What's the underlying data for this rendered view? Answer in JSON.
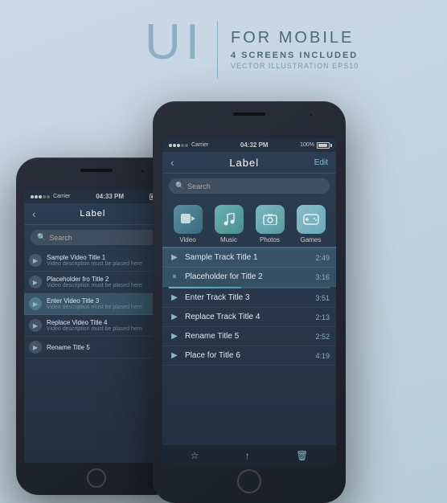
{
  "header": {
    "ui_letters": "UI",
    "divider": "|",
    "for_mobile": "FOR MOBILE",
    "screens_included": "4 SCREENS INCLUDED",
    "vector_info": "VECTOR ILLUSTRATION EPS10"
  },
  "phone_left": {
    "status": {
      "carrier": "Carrier",
      "time": "04:33 PM"
    },
    "nav": {
      "back": "‹",
      "title": "Label"
    },
    "search_placeholder": "Search",
    "videos": [
      {
        "title": "Sample Video Title 1",
        "desc": "Video description must be plased here",
        "active": false
      },
      {
        "title": "Placeholder fro Title 2",
        "desc": "Video description must be plased here",
        "active": false
      },
      {
        "title": "Enter Video Title 3",
        "desc": "Video description must be plased here",
        "active": true
      },
      {
        "title": "Replace Video Title 4",
        "desc": "Video description must be plased here",
        "active": false
      },
      {
        "title": "Rename Title 5",
        "desc": "",
        "active": false
      }
    ]
  },
  "phone_right": {
    "status": {
      "carrier": "Carrier",
      "time": "04:32 PM",
      "battery": "100%"
    },
    "nav": {
      "back": "‹",
      "title": "Label",
      "edit": "Edit"
    },
    "search_placeholder": "Search",
    "categories": [
      {
        "id": "video",
        "label": "Video",
        "icon": "📹"
      },
      {
        "id": "music",
        "label": "Music",
        "icon": "🎵"
      },
      {
        "id": "photos",
        "label": "Photos",
        "icon": "📷"
      },
      {
        "id": "games",
        "label": "Games",
        "icon": "🎮"
      }
    ],
    "tracks": [
      {
        "id": 1,
        "title": "Sample Track Title 1",
        "duration": "2:49",
        "state": "active"
      },
      {
        "id": 2,
        "title": "Placeholder for Title 2",
        "duration": "3:16",
        "state": "playing"
      },
      {
        "id": 3,
        "title": "Enter Track Title 3",
        "duration": "3:51",
        "state": "normal"
      },
      {
        "id": 4,
        "title": "Replace Track Title 4",
        "duration": "2:13",
        "state": "normal"
      },
      {
        "id": 5,
        "title": "Rename Title 5",
        "duration": "2:52",
        "state": "normal"
      },
      {
        "id": 6,
        "title": "Place for Title 6",
        "duration": "4:19",
        "state": "normal"
      }
    ],
    "bottom_icons": [
      "★",
      "↑",
      "🗑"
    ]
  },
  "icons": {
    "play": "▶",
    "pause": "⏸",
    "search": "🔍"
  }
}
